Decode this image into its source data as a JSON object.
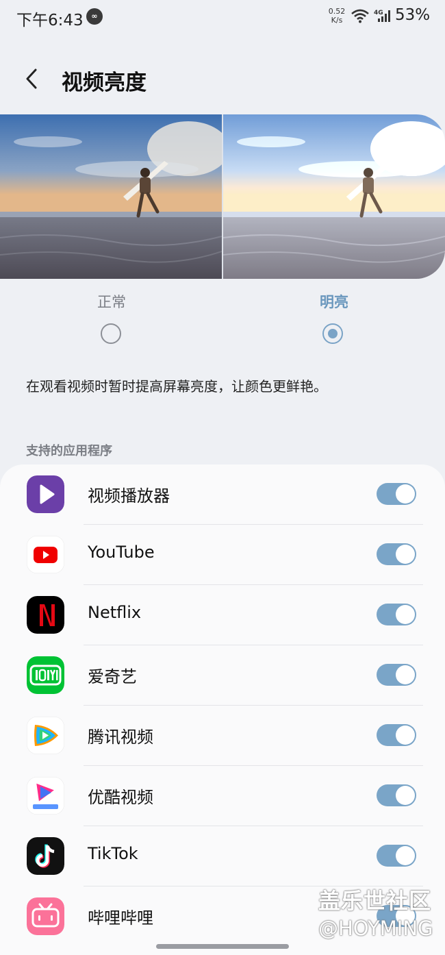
{
  "status_bar": {
    "time": "下午6:43",
    "badge": "∞",
    "speed_value": "0.52",
    "speed_unit": "K/s",
    "network": "4G",
    "battery": "53%"
  },
  "header": {
    "title": "视频亮度"
  },
  "options": {
    "normal_label": "正常",
    "bright_label": "明亮",
    "selected": "明亮"
  },
  "description": "在观看视频时暂时提高屏幕亮度，让颜色更鲜艳。",
  "section_label": "支持的应用程序",
  "apps": [
    {
      "name": "视频播放器",
      "icon": "video-player-icon",
      "enabled": true
    },
    {
      "name": "YouTube",
      "icon": "youtube-icon",
      "enabled": true
    },
    {
      "name": "Netflix",
      "icon": "netflix-icon",
      "enabled": true
    },
    {
      "name": "爱奇艺",
      "icon": "iqiyi-icon",
      "enabled": true
    },
    {
      "name": "腾讯视频",
      "icon": "tencent-video-icon",
      "enabled": true
    },
    {
      "name": "优酷视频",
      "icon": "youku-icon",
      "enabled": true
    },
    {
      "name": "TikTok",
      "icon": "tiktok-icon",
      "enabled": true
    },
    {
      "name": "哔哩哔哩",
      "icon": "bilibili-icon",
      "enabled": true
    }
  ],
  "watermark": {
    "line1": "盖乐世社区",
    "line2": "@HOYMING"
  },
  "colors": {
    "accent": "#7aa5c8",
    "background": "#eef0f4",
    "card": "#fafafb"
  }
}
